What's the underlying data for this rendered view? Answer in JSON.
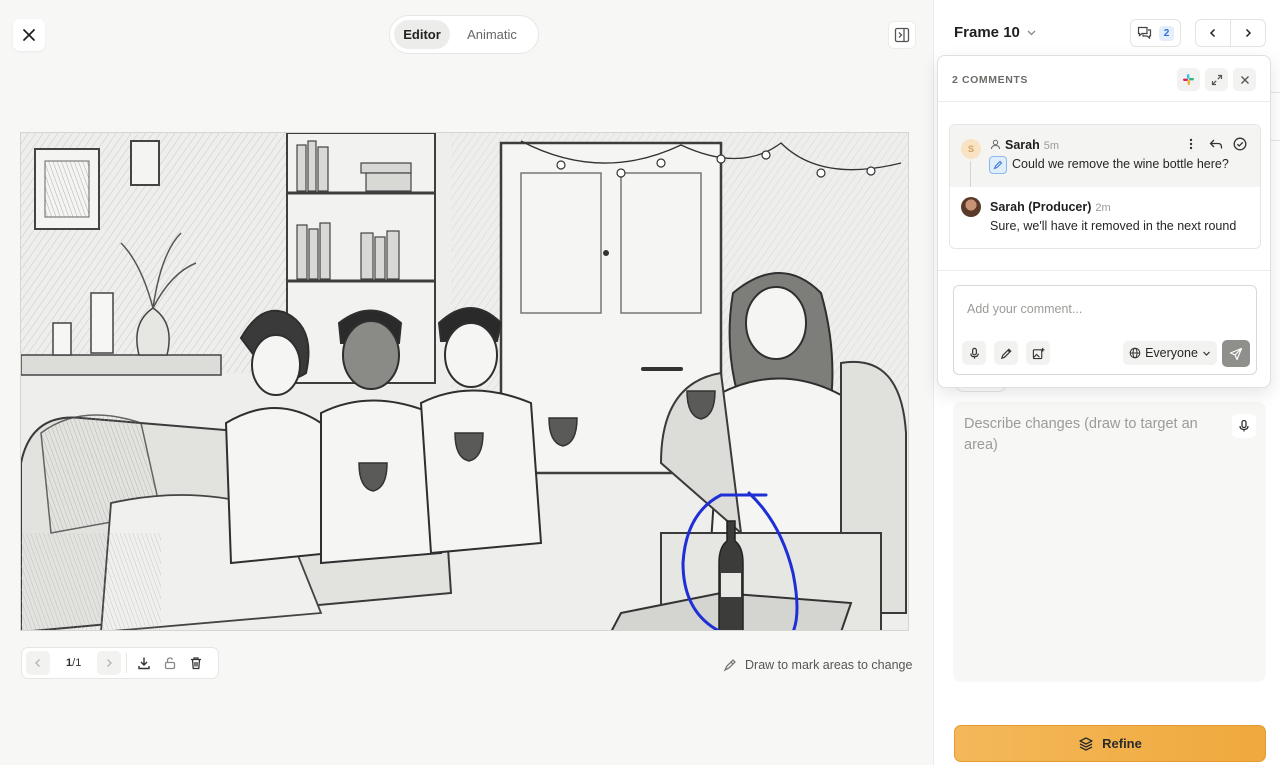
{
  "header": {
    "modes": [
      {
        "label": "Editor",
        "active": true
      },
      {
        "label": "Animatic",
        "active": false
      }
    ]
  },
  "canvas": {
    "page_current": "1",
    "page_separator": "/",
    "page_total": "1",
    "draw_hint": "Draw to mark areas to change"
  },
  "panel": {
    "frame_title": "Frame 10",
    "comment_count": "2",
    "describe_placeholder": "Describe changes (draw to target an area)",
    "refine_label": "Refine"
  },
  "comments_popover": {
    "title": "2 COMMENTS",
    "comments": [
      {
        "avatar_initial": "S",
        "author": "Sarah",
        "time": "5m",
        "text": "Could we remove the wine bottle here?"
      },
      {
        "author": "Sarah (Producer)",
        "time": "2m",
        "text": "Sure, we'll have it removed in the next round"
      }
    ],
    "compose_placeholder": "Add your comment...",
    "audience": "Everyone"
  },
  "colors": {
    "accent_refine": "#f0ad44",
    "badge_blue": "#2d6fd8",
    "annotation_stroke": "#1f2fd6"
  }
}
